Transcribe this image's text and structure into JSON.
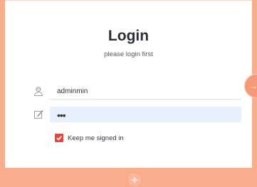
{
  "login": {
    "title": "Login",
    "subtitle": "please login first",
    "username": {
      "value": "adminmin",
      "icon": "user-icon"
    },
    "password": {
      "value": "•••",
      "icon": "pencil-icon"
    },
    "remember": {
      "label": "Keep me signed in",
      "checked": true
    },
    "submit": {
      "icon": "arrow-right-icon",
      "glyph": "→"
    }
  },
  "footer": {
    "add_icon": "plus-icon"
  },
  "colors": {
    "background": "#f8ad8d",
    "card": "#ffffff",
    "checkbox": "#e04a3a",
    "password_fill": "#e9f0fd",
    "button": "#f49a78"
  }
}
